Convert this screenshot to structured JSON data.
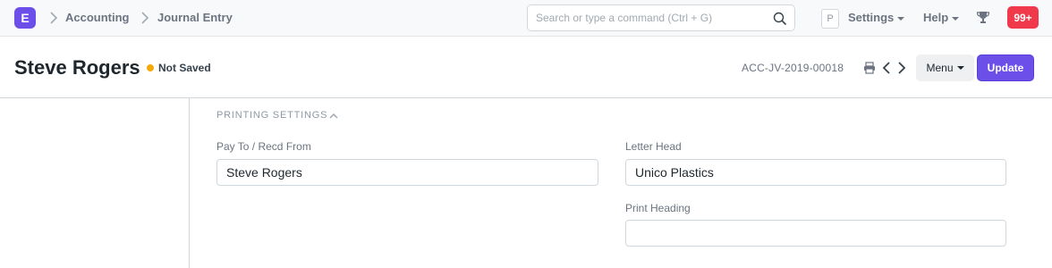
{
  "navbar": {
    "logo_letter": "E",
    "breadcrumbs": [
      "Accounting",
      "Journal Entry"
    ],
    "search_placeholder": "Search or type a command (Ctrl + G)",
    "avatar_letter": "P",
    "settings_label": "Settings",
    "help_label": "Help",
    "notification_count": "99+",
    "colors": {
      "brand": "#6c4fe8",
      "notification": "#f0394a"
    }
  },
  "page": {
    "title": "Steve Rogers",
    "status": "Not Saved",
    "status_color": "#f4a90c",
    "doc_name": "ACC-JV-2019-00018",
    "menu_label": "Menu",
    "update_label": "Update"
  },
  "section": {
    "heading": "PRINTING SETTINGS",
    "fields": {
      "pay_to": {
        "label": "Pay To / Recd From",
        "value": "Steve Rogers"
      },
      "letter_head": {
        "label": "Letter Head",
        "value": "Unico Plastics"
      },
      "print_heading": {
        "label": "Print Heading",
        "value": ""
      }
    }
  }
}
